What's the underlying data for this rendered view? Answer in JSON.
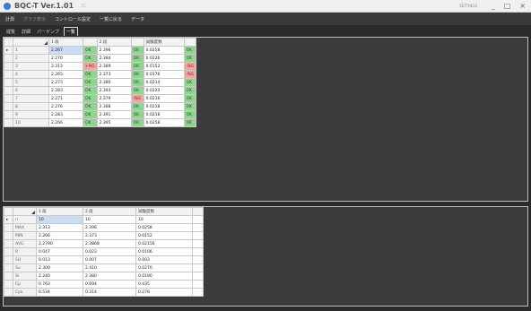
{
  "window": {
    "title": "BQC-T Ver.1.01",
    "subtitle": "3C",
    "user": "SETTINGS",
    "controls": [
      "_",
      "□",
      "×"
    ]
  },
  "menu": [
    {
      "label": "計測",
      "dim": false
    },
    {
      "label": "グラフ表示",
      "dim": true
    },
    {
      "label": "コントロール設定",
      "dim": false
    },
    {
      "label": "一覧に戻る",
      "dim": false
    },
    {
      "label": "データ",
      "dim": false
    }
  ],
  "tabs": [
    {
      "label": "縦覧",
      "active": false
    },
    {
      "label": "詳細",
      "active": false
    },
    {
      "label": "パーゲンプ",
      "active": false
    },
    {
      "label": "一覧",
      "active": true
    }
  ],
  "measure_table": {
    "headers": [
      "1 段",
      "2 段",
      "試験度数"
    ],
    "rows": [
      {
        "no": "1",
        "v1": "2.267",
        "j1": "OK",
        "v2": "2.396",
        "j2": "OK",
        "v3": "0.0258",
        "j3": "OK",
        "current": true
      },
      {
        "no": "2",
        "v1": "2.270",
        "j1": "OK",
        "v2": "2.384",
        "j2": "OK",
        "v3": "0.0226",
        "j3": "OK",
        "current": false
      },
      {
        "no": "3",
        "v1": "2.313",
        "j1": "+NG",
        "v2": "2.389",
        "j2": "OK",
        "v3": "0.0152",
        "j3": "-NG",
        "current": false
      },
      {
        "no": "4",
        "v1": "2.265",
        "j1": "OK",
        "v2": "2.373",
        "j2": "OK",
        "v3": "0.0176",
        "j3": "-NG",
        "current": false
      },
      {
        "no": "5",
        "v1": "2.273",
        "j1": "OK",
        "v2": "2.380",
        "j2": "OK",
        "v3": "0.0214",
        "j3": "OK",
        "current": false
      },
      {
        "no": "6",
        "v1": "2.283",
        "j1": "OK",
        "v2": "2.393",
        "j2": "OK",
        "v3": "0.0220",
        "j3": "OK",
        "current": false
      },
      {
        "no": "7",
        "v1": "2.271",
        "j1": "OK",
        "v2": "2.379",
        "j2": "-NG",
        "v3": "0.0216",
        "j3": "OK",
        "current": false
      },
      {
        "no": "8",
        "v1": "2.276",
        "j1": "OK",
        "v2": "2.388",
        "j2": "OK",
        "v3": "0.0218",
        "j3": "OK",
        "current": false
      },
      {
        "no": "9",
        "v1": "2.283",
        "j1": "OK",
        "v2": "2.391",
        "j2": "OK",
        "v3": "0.0218",
        "j3": "OK",
        "current": false
      },
      {
        "no": "10",
        "v1": "2.266",
        "j1": "OK",
        "v2": "2.395",
        "j2": "OK",
        "v3": "0.0258",
        "j3": "OK",
        "current": false
      }
    ]
  },
  "stats_table": {
    "headers": [
      "1 段",
      "2 段",
      "試験度数"
    ],
    "rows": [
      {
        "label": "n",
        "v1": "10",
        "v2": "10",
        "v3": "10",
        "current": true
      },
      {
        "label": "MAX",
        "v1": "2.313",
        "v2": "2.396",
        "v3": "0.0258",
        "current": false
      },
      {
        "label": "MIN",
        "v1": "2.266",
        "v2": "2.373",
        "v3": "0.0152",
        "current": false
      },
      {
        "label": "AVG",
        "v1": "2.2790",
        "v2": "2.3868",
        "v3": "0.02156",
        "current": false
      },
      {
        "label": "R",
        "v1": "0.047",
        "v2": "0.023",
        "v3": "0.0106",
        "current": false
      },
      {
        "label": "SH",
        "v1": "0.013",
        "v2": "0.007",
        "v3": "0.003",
        "current": false
      },
      {
        "label": "Su",
        "v1": "2.300",
        "v2": "2.410",
        "v3": "0.0270",
        "current": false
      },
      {
        "label": "Sl",
        "v1": "2.240",
        "v2": "2.380",
        "v3": "0.0190",
        "current": false
      },
      {
        "label": "Cp",
        "v1": "0.763",
        "v2": "0.694",
        "v3": "0.435",
        "current": false
      },
      {
        "label": "Cpk",
        "v1": "0.534",
        "v2": "0.314",
        "v3": "0.278",
        "current": false
      }
    ]
  }
}
